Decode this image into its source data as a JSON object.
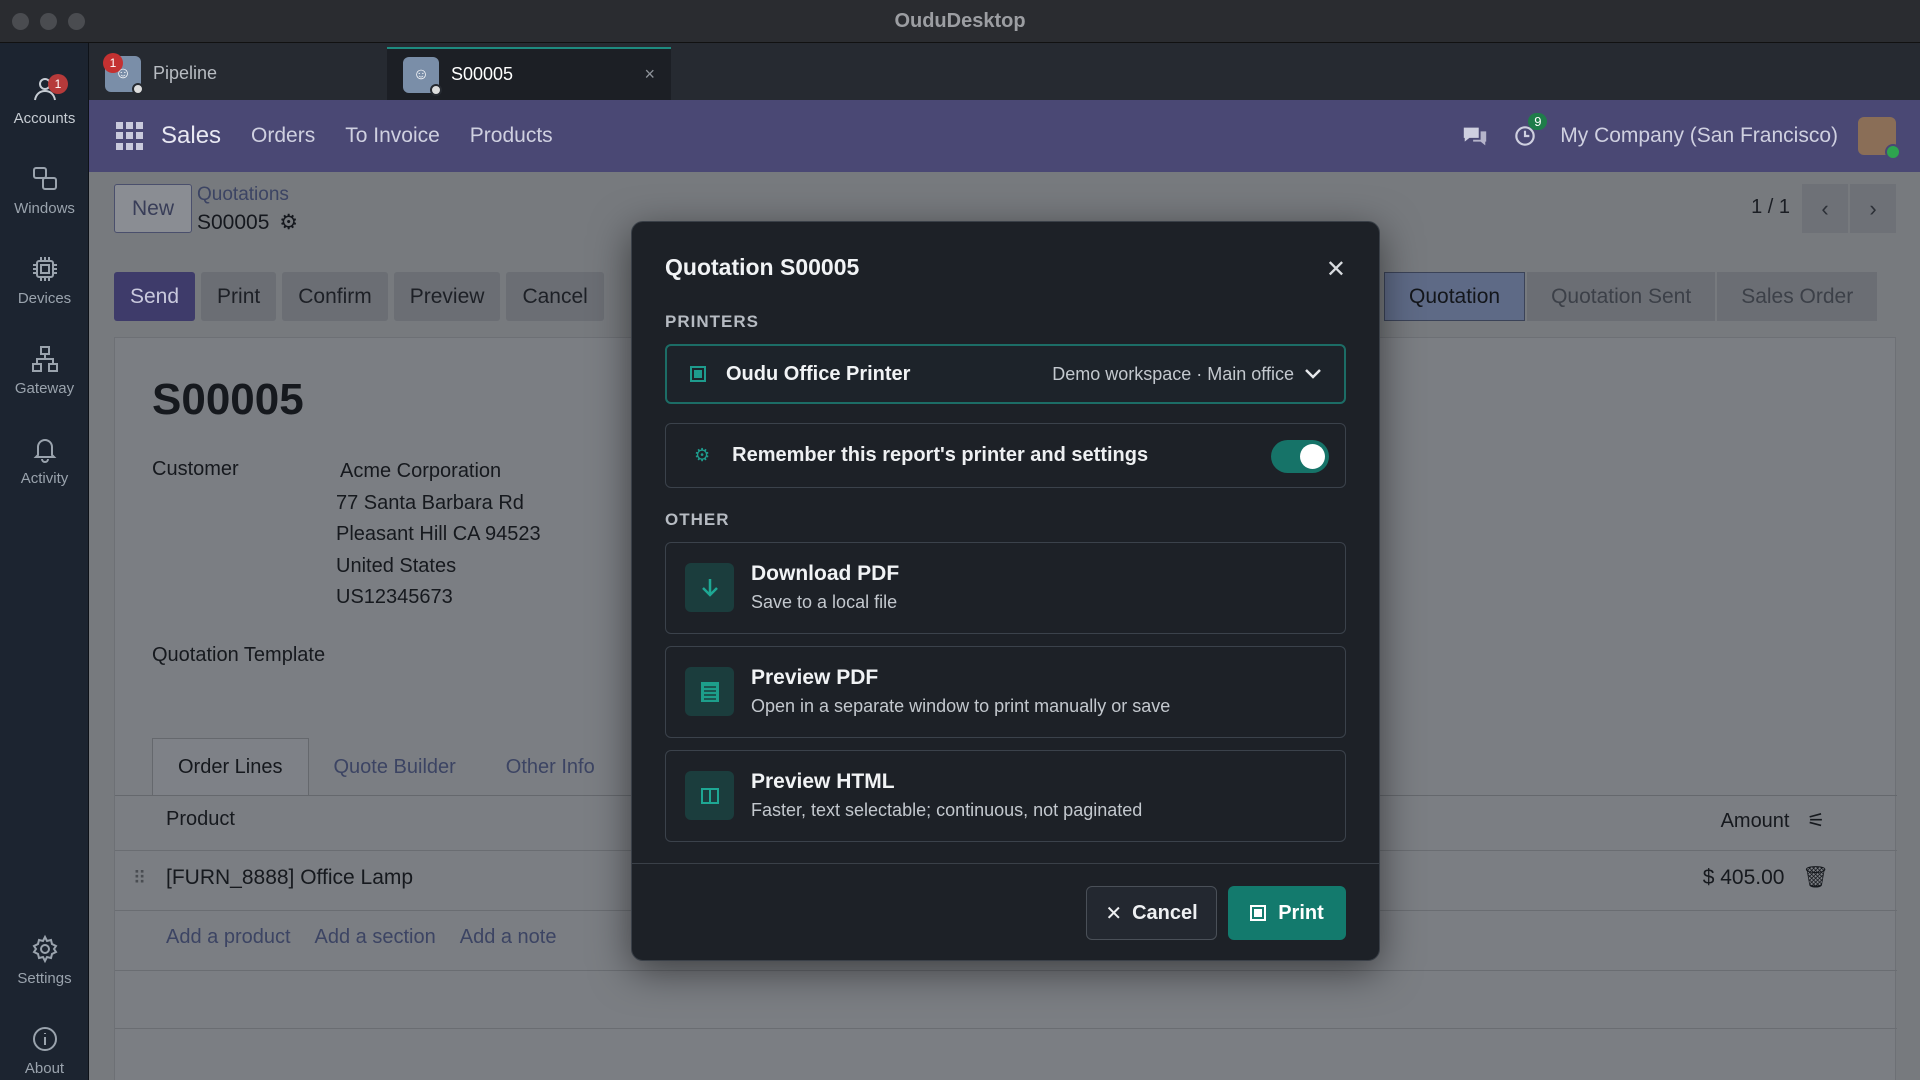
{
  "window": {
    "title": "OuduDesktop"
  },
  "rail": {
    "items": [
      {
        "label": "Accounts",
        "icon": "user-icon",
        "badge": "1"
      },
      {
        "label": "Windows",
        "icon": "windows-icon"
      },
      {
        "label": "Devices",
        "icon": "chip-icon"
      },
      {
        "label": "Gateway",
        "icon": "network-icon"
      },
      {
        "label": "Activity",
        "icon": "bell-icon"
      },
      {
        "label": "Settings",
        "icon": "gear-icon"
      },
      {
        "label": "About",
        "icon": "info-icon"
      }
    ]
  },
  "tabs": [
    {
      "label": "Pipeline",
      "badge": "1"
    },
    {
      "label": "S00005",
      "close": "×"
    }
  ],
  "nav": {
    "brand": "Sales",
    "links": [
      "Orders",
      "To Invoice",
      "Products"
    ],
    "activity_badge": "9",
    "company": "My Company (San Francisco)"
  },
  "page": {
    "new_label": "New",
    "breadcrumb_parent": "Quotations",
    "breadcrumb_current": "S00005",
    "pager": "1 / 1",
    "actions": [
      "Send",
      "Print",
      "Confirm",
      "Preview",
      "Cancel"
    ],
    "stages": [
      "Quotation",
      "Quotation Sent",
      "Sales Order"
    ],
    "title": "S00005",
    "customer_label": "Customer",
    "customer_lines": [
      "Acme Corporation",
      "77 Santa Barbara Rd",
      "Pleasant Hill CA 94523",
      "United States",
      "US12345673"
    ],
    "template_label": "Quotation Template",
    "form_tabs": [
      "Order Lines",
      "Quote Builder",
      "Other Info"
    ],
    "col_product": "Product",
    "col_amount": "Amount",
    "line_product": "[FURN_8888] Office Lamp",
    "line_amount": "$ 405.00",
    "add_links": [
      "Add a product",
      "Add a section",
      "Add a note"
    ]
  },
  "modal": {
    "title": "Quotation S00005",
    "printers_label": "PRINTERS",
    "printer_name": "Oudu Office Printer",
    "printer_location": "Demo workspace · Main office",
    "remember_label": "Remember this report's printer and settings",
    "remember_enabled": true,
    "other_label": "OTHER",
    "options": [
      {
        "title": "Download PDF",
        "subtitle": "Save to a local file",
        "icon": "download-icon"
      },
      {
        "title": "Preview PDF",
        "subtitle": "Open in a separate window to print manually or save",
        "icon": "document-icon"
      },
      {
        "title": "Preview HTML",
        "subtitle": "Faster, text selectable; continuous, not paginated",
        "icon": "columns-icon"
      }
    ],
    "cancel_label": "Cancel",
    "print_label": "Print",
    "accent_color": "#137a6d"
  }
}
